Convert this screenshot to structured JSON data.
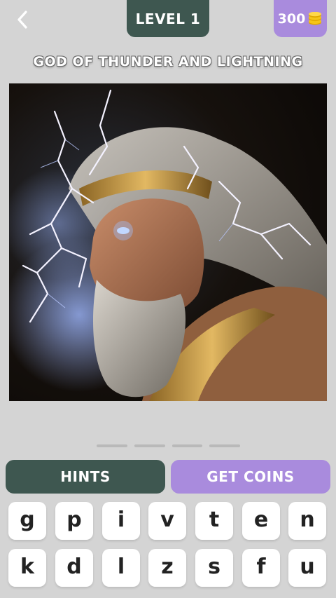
{
  "header": {
    "back_icon": "chevron-left-icon",
    "level_label": "LEVEL 1",
    "coins": "300",
    "coin_icon": "coin-stack-icon"
  },
  "puzzle": {
    "title": "GOD OF THUNDER AND LIGHTNING",
    "image_subject": "bearded thunder god with golden headband and armor surrounded by lightning",
    "answer_slots": 4
  },
  "actions": {
    "hints_label": "HINTS",
    "get_coins_label": "GET COINS"
  },
  "keyboard": {
    "row1": [
      "g",
      "p",
      "i",
      "v",
      "t",
      "e",
      "n"
    ],
    "row2": [
      "k",
      "d",
      "l",
      "z",
      "s",
      "f",
      "u"
    ]
  },
  "colors": {
    "background": "#d4d4d4",
    "primary_dark": "#3e5750",
    "accent_purple": "#a98bdd",
    "coin_gold": "#f5c518"
  }
}
